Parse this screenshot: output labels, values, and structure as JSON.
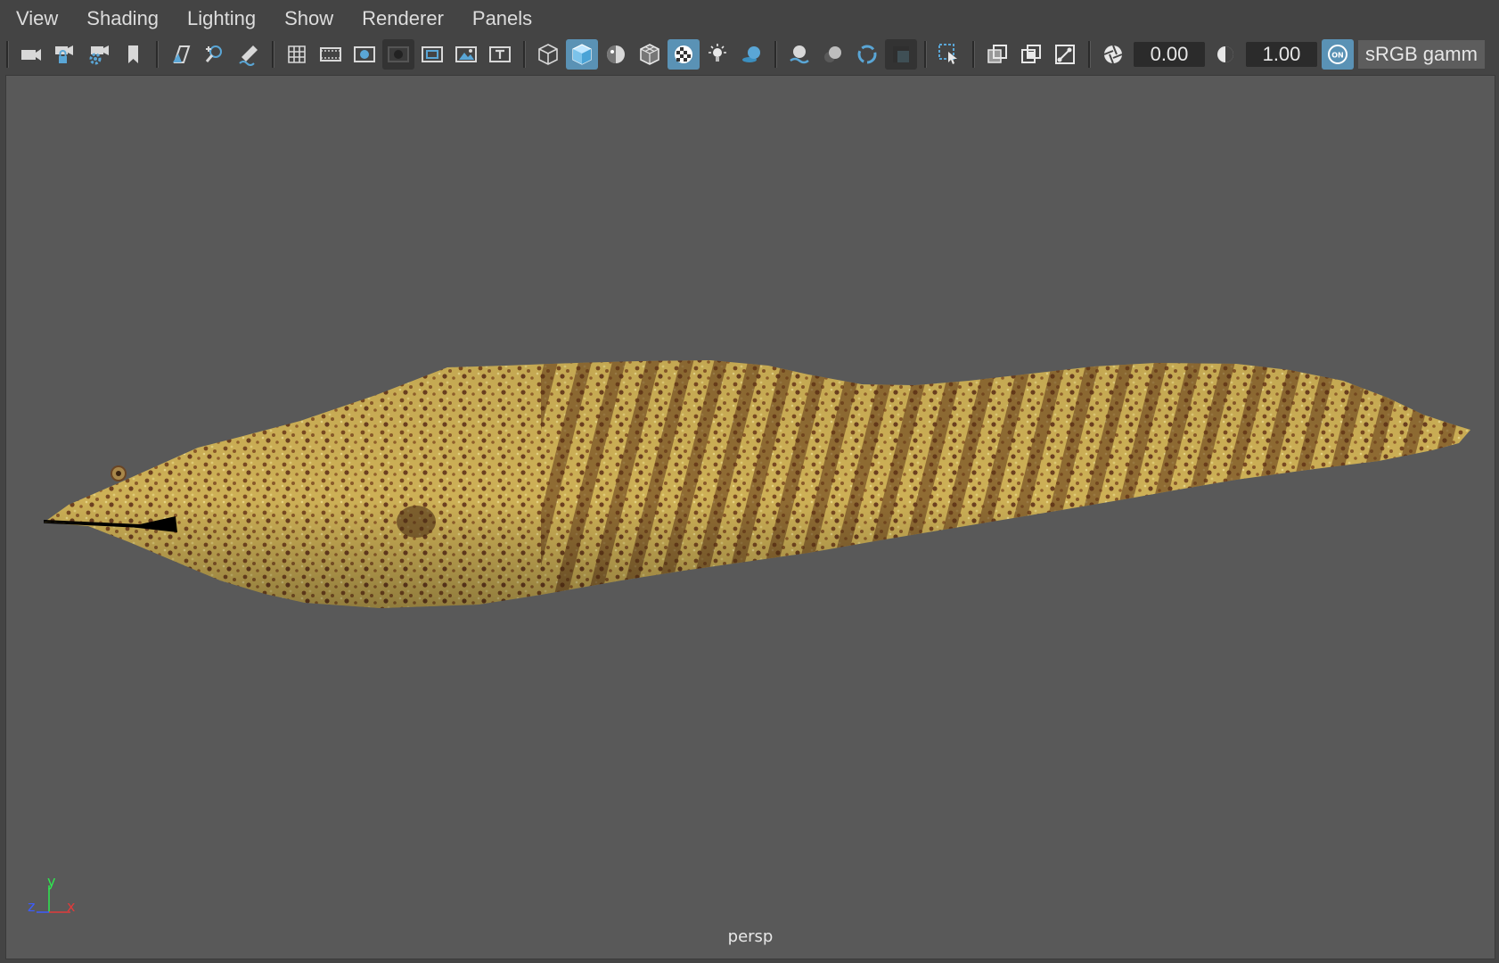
{
  "menubar": {
    "items": [
      "View",
      "Shading",
      "Lighting",
      "Show",
      "Renderer",
      "Panels"
    ]
  },
  "toolbar": {
    "exposure_value": "0.00",
    "gamma_value": "1.00",
    "color_management_badge": "ON",
    "view_transform_label": "sRGB gamm",
    "icons": [
      "select-camera-icon",
      "lock-camera-icon",
      "camera-attributes-icon",
      "bookmark-icon",
      "image-plane-icon",
      "2d-pan-zoom-icon",
      "grease-pencil-icon",
      "grid-icon",
      "film-gate-icon",
      "resolution-gate-icon",
      "gate-mask-icon",
      "field-chart-icon",
      "safe-action-icon",
      "safe-title-icon",
      "wireframe-icon",
      "smooth-shade-icon",
      "default-material-icon",
      "wireframe-on-shaded-icon",
      "textured-icon",
      "use-all-lights-icon",
      "shadows-icon",
      "screen-space-ambient-occlusion-icon",
      "motion-blur-icon",
      "multisample-anti-aliasing-icon",
      "depth-of-field-icon",
      "isolate-select-icon",
      "xray-icon",
      "xray-active-components-icon",
      "xray-joints-icon",
      "exposure-icon",
      "gamma-icon",
      "color-management-icon"
    ]
  },
  "viewport": {
    "camera_label": "persp",
    "axis": {
      "y": "y",
      "z": "z",
      "x": "x"
    },
    "background_color": "#595959"
  }
}
